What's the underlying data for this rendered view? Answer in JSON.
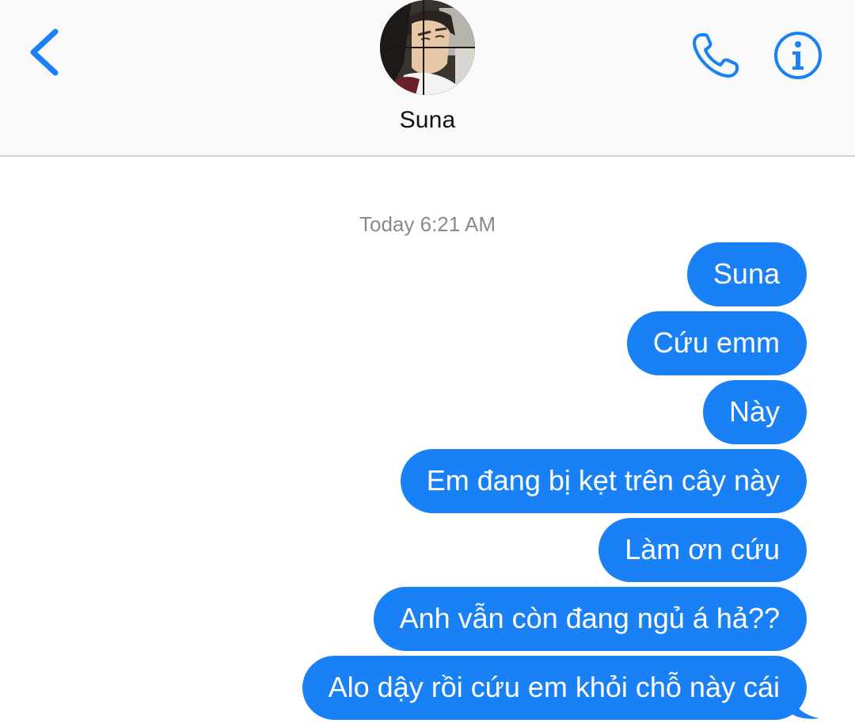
{
  "header": {
    "contact_name": "Suna",
    "back_icon": "chevron-left-icon",
    "call_icon": "phone-icon",
    "info_icon": "info-icon",
    "accent_color": "#1a80f5"
  },
  "conversation": {
    "timestamp": "Today 6:21 AM",
    "messages": [
      {
        "text": "Suna",
        "sender": "me"
      },
      {
        "text": "Cứu emm",
        "sender": "me"
      },
      {
        "text": "Này",
        "sender": "me"
      },
      {
        "text": "Em đang bị kẹt trên cây này",
        "sender": "me"
      },
      {
        "text": "Làm ơn cứu",
        "sender": "me"
      },
      {
        "text": "Anh vẫn còn đang ngủ á hả??",
        "sender": "me"
      },
      {
        "text": "Alo dậy rồi cứu em khỏi chỗ này cái",
        "sender": "me"
      }
    ]
  }
}
